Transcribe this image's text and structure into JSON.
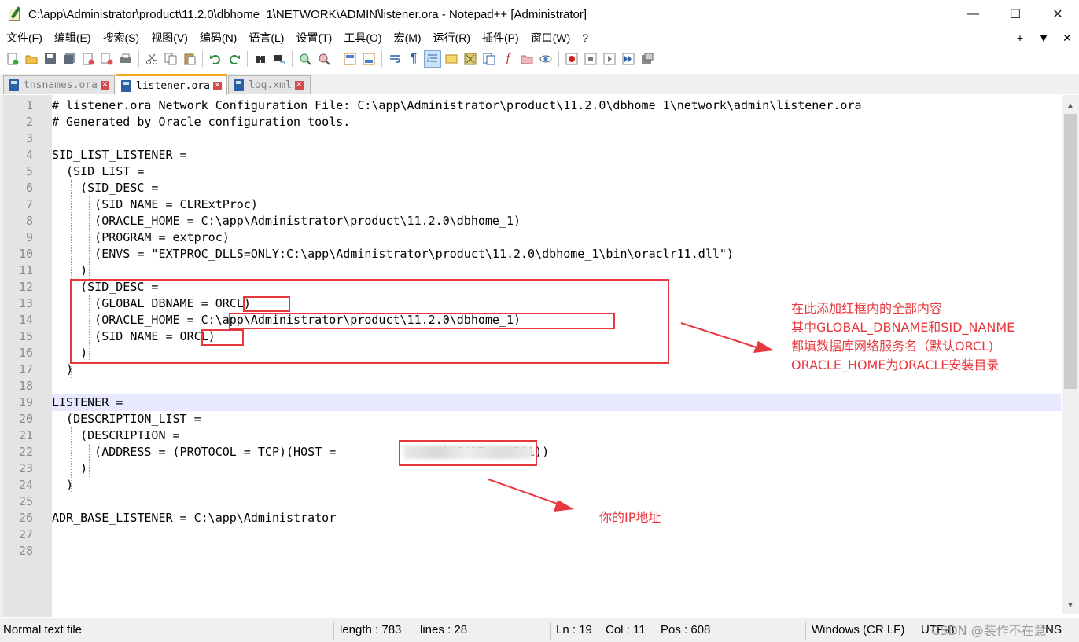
{
  "window": {
    "title": "C:\\app\\Administrator\\product\\11.2.0\\dbhome_1\\NETWORK\\ADMIN\\listener.ora - Notepad++ [Administrator]",
    "minimize": "—",
    "maximize": "☐",
    "close": "✕"
  },
  "menu": {
    "items": [
      "文件(F)",
      "编辑(E)",
      "搜索(S)",
      "视图(V)",
      "编码(N)",
      "语言(L)",
      "设置(T)",
      "工具(O)",
      "宏(M)",
      "运行(R)",
      "插件(P)",
      "窗口(W)",
      "?"
    ],
    "right": [
      "+",
      "▼",
      "✕"
    ]
  },
  "tabs": [
    {
      "label": "tnsnames.ora",
      "active": false
    },
    {
      "label": "listener.ora",
      "active": true
    },
    {
      "label": "log.xml",
      "active": false
    }
  ],
  "editor": {
    "line_numbers": [
      "1",
      "2",
      "3",
      "4",
      "5",
      "6",
      "7",
      "8",
      "9",
      "10",
      "11",
      "12",
      "13",
      "14",
      "15",
      "16",
      "17",
      "18",
      "19",
      "20",
      "21",
      "22",
      "23",
      "24",
      "25",
      "26",
      "27",
      "28"
    ],
    "lines": [
      "# listener.ora Network Configuration File: C:\\app\\Administrator\\product\\11.2.0\\dbhome_1\\network\\admin\\listener.ora",
      "# Generated by Oracle configuration tools.",
      "",
      "SID_LIST_LISTENER =",
      "  (SID_LIST =",
      "    (SID_DESC =",
      "      (SID_NAME = CLRExtProc)",
      "      (ORACLE_HOME = C:\\app\\Administrator\\product\\11.2.0\\dbhome_1)",
      "      (PROGRAM = extproc)",
      "      (ENVS = \"EXTPROC_DLLS=ONLY:C:\\app\\Administrator\\product\\11.2.0\\dbhome_1\\bin\\oraclr11.dll\")",
      "    )",
      "    (SID_DESC =",
      "      (GLOBAL_DBNAME = ORCL)",
      "      (ORACLE_HOME = C:\\app\\Administrator\\product\\11.2.0\\dbhome_1)",
      "      (SID_NAME = ORCL)",
      "    )",
      "  )",
      "",
      "LISTENER =",
      "  (DESCRIPTION_LIST =",
      "    (DESCRIPTION =",
      "      (ADDRESS = (PROTOCOL = TCP)(HOST =               )(PORT = 1521))",
      "    )",
      "  )",
      "",
      "ADR_BASE_LISTENER = C:\\app\\Administrator",
      "",
      ""
    ],
    "current_line": 19
  },
  "annotations": {
    "note_block": [
      "在此添加红框内的全部内容",
      "其中GLOBAL_DBNAME和SID_NANME",
      "都填数据库网络服务名（默认ORCL)",
      "ORACLE_HOME为ORACLE安装目录"
    ],
    "note_ip": "你的IP地址",
    "color": "#e8383d"
  },
  "status": {
    "file_type": "Normal text file",
    "length": "length : 783",
    "lines": "lines : 28",
    "ln": "Ln : 19",
    "col": "Col : 11",
    "pos": "Pos : 608",
    "eol": "Windows (CR LF)",
    "encoding": "UTF-8",
    "mode": "INS"
  },
  "watermark": "CSDN @装作不在意"
}
